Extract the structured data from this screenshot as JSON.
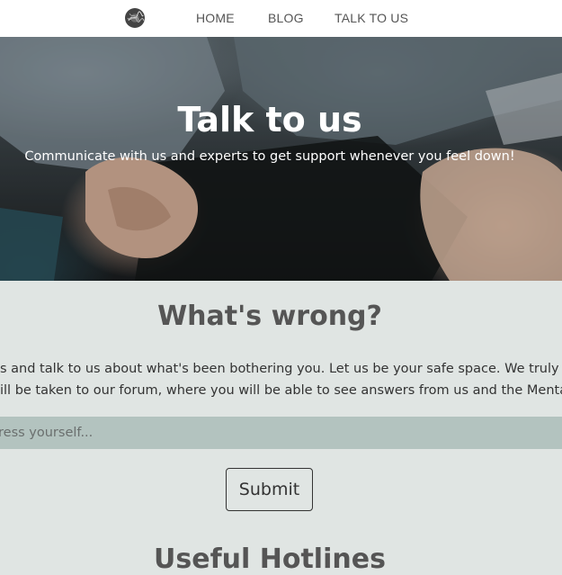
{
  "nav": {
    "logo_icon": "circle-logo-icon",
    "links": [
      "HOME",
      "BLOG",
      "TALK TO US"
    ]
  },
  "hero": {
    "title": "Talk to us",
    "subtitle": "Communicate with us and experts to get support whenever you feel down!"
  },
  "main": {
    "heading": "What's wrong?",
    "paragraph_line_1": "s and talk to us about what's been bothering you. Let us be your safe space. We truly war",
    "paragraph_line_2": "ill be taken to our forum, where you will be able to see answers from us and the Mental S",
    "input_placeholder": "ress yourself...",
    "submit_label": "Submit",
    "next_heading": "Useful Hotlines"
  },
  "colors": {
    "page_background": "#e0e5e3",
    "input_background": "#b3c3bf",
    "heading_text": "#555555"
  }
}
